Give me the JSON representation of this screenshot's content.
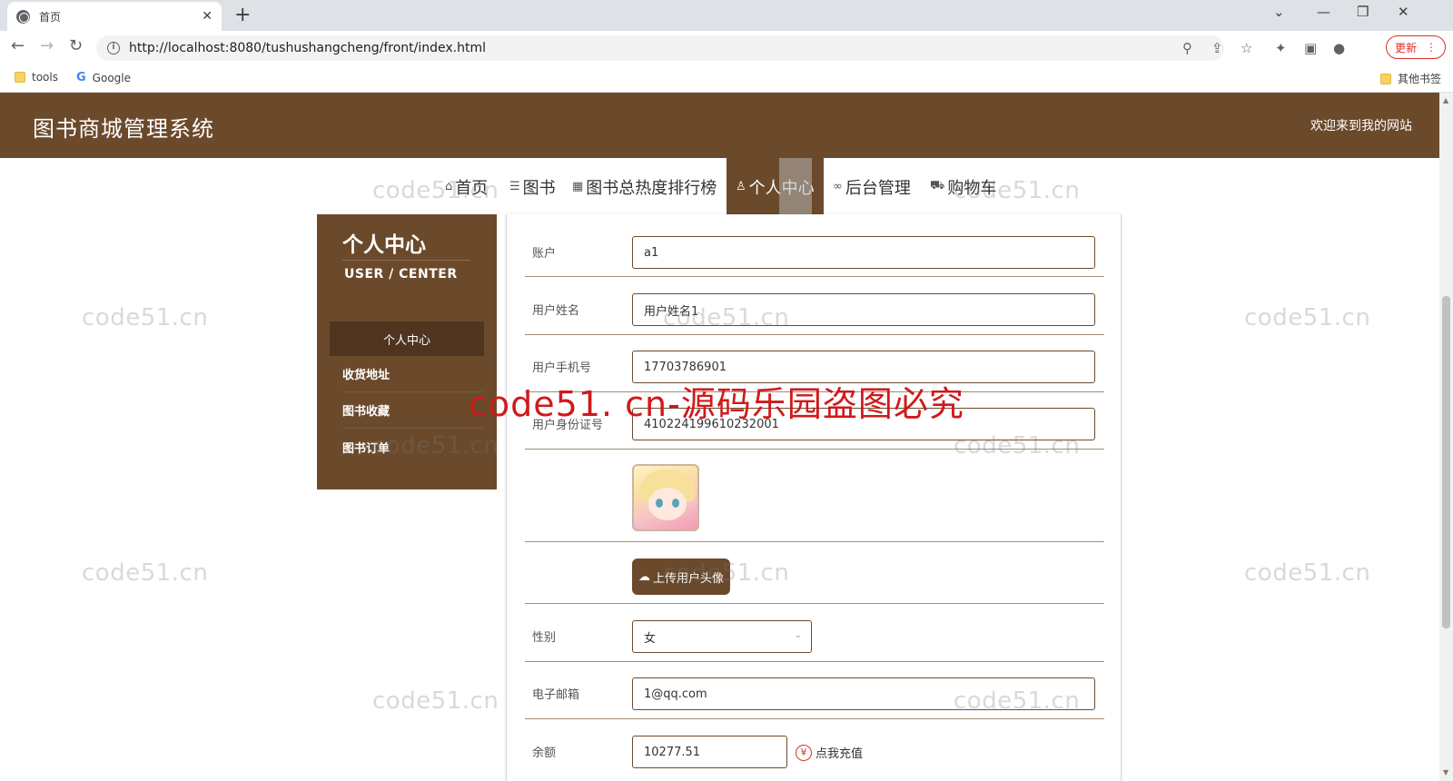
{
  "browser": {
    "tab_title": "首页",
    "url": "http://localhost:8080/tushushangcheng/front/index.html",
    "update_label": "更新",
    "bookmarks": [
      "tools",
      "Google"
    ],
    "other_bookmarks": "其他书签"
  },
  "header": {
    "title": "图书商城管理系统",
    "welcome": "欢迎来到我的网站"
  },
  "nav": {
    "items": [
      {
        "label": "首页",
        "icon": "home-icon"
      },
      {
        "label": "图书",
        "icon": "layers-icon"
      },
      {
        "label": "图书总热度排行榜",
        "icon": "gift-icon"
      },
      {
        "label": "个人中心",
        "icon": "user-icon"
      },
      {
        "label": "后台管理",
        "icon": "link-icon"
      },
      {
        "label": "购物车",
        "icon": "cart-icon"
      }
    ],
    "active": "个人中心"
  },
  "sidebar": {
    "title": "个人中心",
    "subtitle": "USER / CENTER",
    "items": [
      "个人中心",
      "收货地址",
      "图书收藏",
      "图书订单"
    ],
    "active_index": 0
  },
  "form": {
    "account": {
      "label": "账户",
      "value": "a1"
    },
    "name": {
      "label": "用户姓名",
      "value": "用户姓名1"
    },
    "phone": {
      "label": "用户手机号",
      "value": "17703786901"
    },
    "id_card": {
      "label": "用户身份证号",
      "value": "410224199610232001"
    },
    "upload_label": "上传用户头像",
    "gender": {
      "label": "性别",
      "value": "女"
    },
    "email": {
      "label": "电子邮箱",
      "value": "1@qq.com"
    },
    "balance": {
      "label": "余额",
      "value": "10277.51"
    },
    "recharge_label": "点我充值"
  },
  "watermark": {
    "text": "code51.cn",
    "banner": "code51. cn-源码乐园盗图必究"
  },
  "colors": {
    "brand": "#6b4a2c",
    "brand_dark": "#4f3520",
    "watermark_red": "#d0191b"
  }
}
